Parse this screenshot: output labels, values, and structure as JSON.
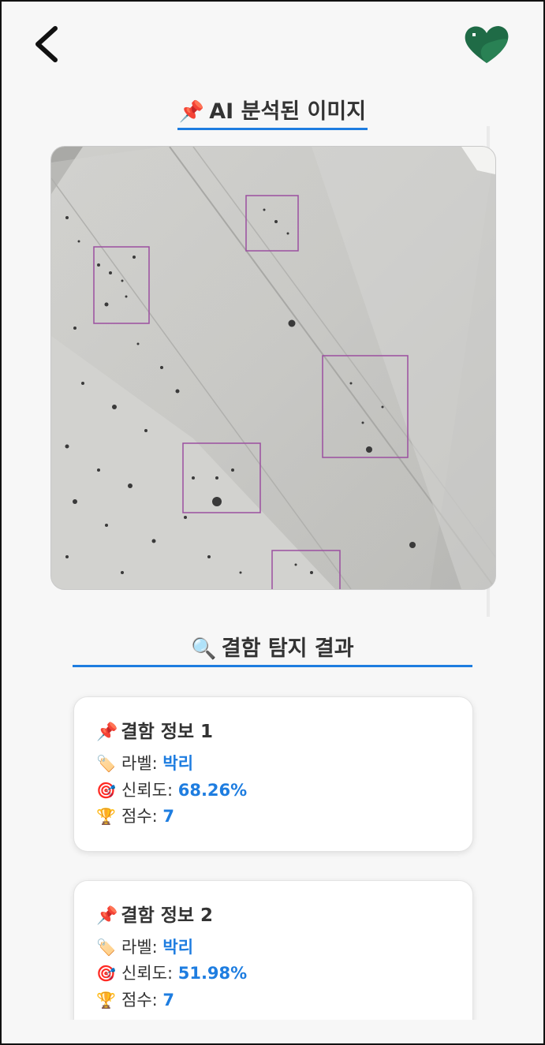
{
  "header": {
    "back_icon": "chevron-left-icon",
    "logo_icon": "green-heart-house-logo",
    "logo_color": "#1f6b46"
  },
  "analyzed_section": {
    "emoji": "📌",
    "title": "AI 분석된 이미지"
  },
  "results_section": {
    "emoji": "🔍",
    "title": "결함 탐지 결과"
  },
  "accent_color": "#1e7de0",
  "box_color": "#9b4fa0",
  "defects": [
    {
      "title_emoji": "📌",
      "title": "결함 정보 1",
      "label_emoji": "🏷️",
      "label_key": "라벨:",
      "label_value": "박리",
      "confidence_emoji": "🎯",
      "confidence_key": "신뢰도:",
      "confidence_value": "68.26%",
      "score_emoji": "🏆",
      "score_key": "점수:",
      "score_value": "7"
    },
    {
      "title_emoji": "📌",
      "title": "결함 정보 2",
      "label_emoji": "🏷️",
      "label_key": "라벨:",
      "label_value": "박리",
      "confidence_emoji": "🎯",
      "confidence_key": "신뢰도:",
      "confidence_value": "51.98%",
      "score_emoji": "🏆",
      "score_key": "점수:",
      "score_value": "7"
    }
  ]
}
